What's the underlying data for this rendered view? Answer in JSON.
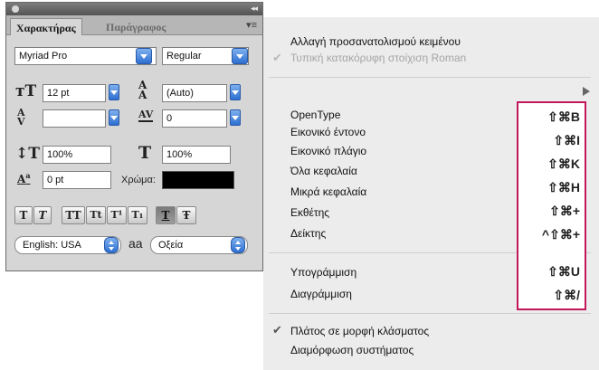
{
  "panel": {
    "tabs": {
      "character": "Χαρακτήρας",
      "paragraph": "Παράγραφος"
    },
    "font_family": "Myriad Pro",
    "font_style": "Regular",
    "font_size": "12 pt",
    "leading": "(Auto)",
    "kerning": "",
    "tracking": "0",
    "vertical_scale": "100%",
    "horizontal_scale": "100%",
    "baseline_shift": "0 pt",
    "color_label": "Χρώμα:",
    "color_value": "#000000",
    "style_buttons": [
      "T",
      "T",
      "TT",
      "Tt",
      "T¹",
      "T₁",
      "T",
      "Ŧ"
    ],
    "language": "English: USA",
    "antialias_label": "aa",
    "antialias": "Οξεία"
  },
  "menu": {
    "items": [
      {
        "label": "Αλλαγή προσανατολισμού κειμένου",
        "enabled": true
      },
      {
        "label": "Τυπική κατακόρυφη στοίχιση Roman",
        "enabled": false,
        "checked": true
      },
      {
        "label": "OpenType",
        "shortcut": "⇧⌘B"
      },
      {
        "label": "Εικονικό έντονο",
        "shortcut": "⇧⌘I"
      },
      {
        "label": "Εικονικό πλάγιο",
        "shortcut": "⇧⌘K"
      },
      {
        "label": "Όλα κεφαλαία",
        "shortcut": "⇧⌘H"
      },
      {
        "label": "Μικρά κεφαλαία",
        "shortcut": "⇧⌘+"
      },
      {
        "label": "Εκθέτης",
        "shortcut": "^⇧⌘+"
      },
      {
        "label": "Δείκτης",
        "shortcut": "⇧⌘U"
      },
      {
        "label": "Υπογράμμιση",
        "shortcut": "⇧⌘/"
      },
      {
        "label": "Διαγράμμιση"
      },
      {
        "label": "Πλάτος σε μορφή κλάσματος",
        "checked": true
      },
      {
        "label": "Διαμόρφωση συστήματος"
      }
    ]
  },
  "colors": {
    "highlight_box": "#c2185b",
    "dropdown_blue": "#2d6fd1"
  }
}
